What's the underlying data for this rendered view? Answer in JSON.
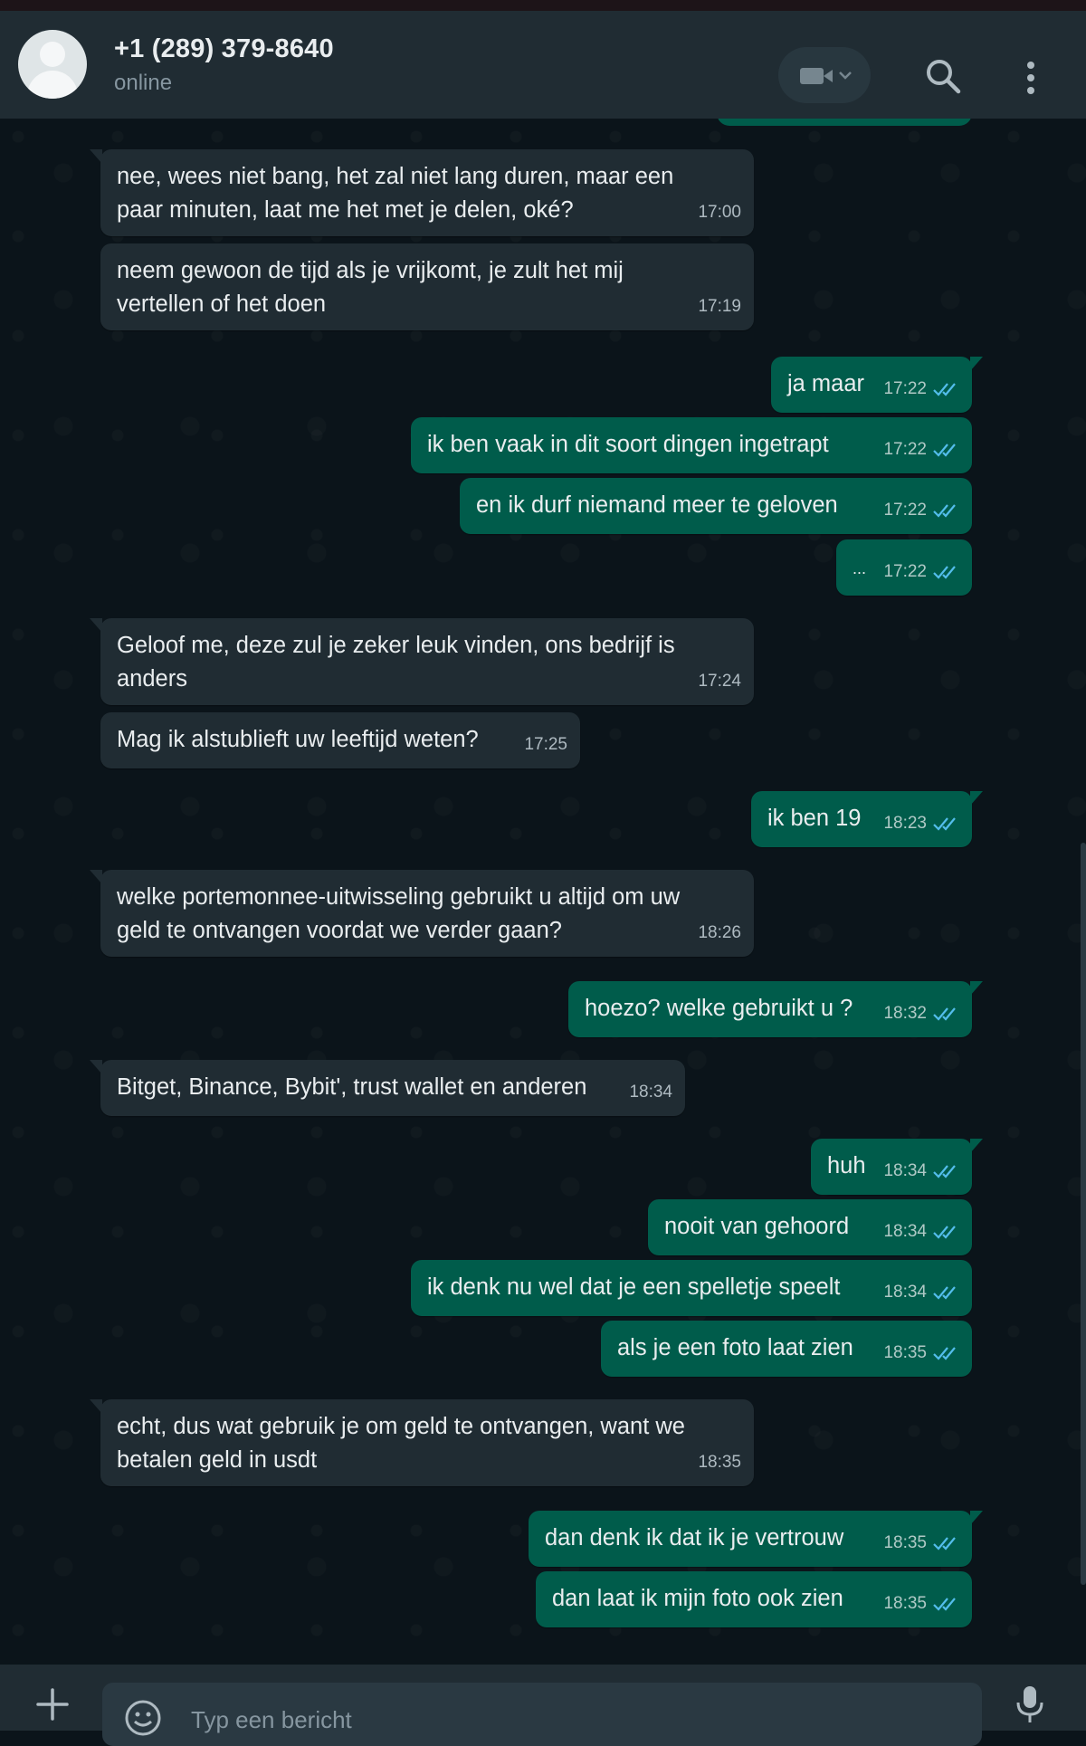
{
  "header": {
    "contact_name": "+1 (289) 379-8640",
    "status": "online"
  },
  "icons": {
    "avatar": "default-user-avatar",
    "video": "video-camera-icon",
    "search": "search-icon",
    "menu": "vertical-dots-icon",
    "attach": "plus-icon",
    "emoji": "smiley-icon",
    "mic": "microphone-icon",
    "read_receipt": "double-check-icon"
  },
  "colors": {
    "background": "#0b141a",
    "header": "#202c33",
    "incoming_bubble": "#202c33",
    "outgoing_bubble": "#005c4b",
    "read_tick": "#53bdeb"
  },
  "messages": [
    {
      "dir": "in",
      "text": "nee, wees niet bang, het zal niet lang duren, maar een\npaar minuten, laat me het met je delen, oké?",
      "time": "17:00"
    },
    {
      "dir": "in",
      "text": "neem gewoon de tijd als je vrijkomt, je zult het mij\nvertellen of het doen",
      "time": "17:19"
    },
    {
      "dir": "out",
      "text": "ja maar",
      "time": "17:22"
    },
    {
      "dir": "out",
      "text": "ik ben vaak in dit soort dingen ingetrapt",
      "time": "17:22"
    },
    {
      "dir": "out",
      "text": "en ik durf niemand meer te geloven",
      "time": "17:22"
    },
    {
      "dir": "out",
      "text": "...",
      "time": "17:22"
    },
    {
      "dir": "in",
      "text": "Geloof me, deze zul je zeker leuk vinden, ons bedrijf is\nanders",
      "time": "17:24"
    },
    {
      "dir": "in",
      "text": "Mag ik alstublieft uw leeftijd weten?",
      "time": "17:25"
    },
    {
      "dir": "out",
      "text": "ik ben 19",
      "time": "18:23"
    },
    {
      "dir": "in",
      "text": "welke portemonnee-uitwisseling gebruikt u altijd om uw\ngeld te ontvangen voordat we verder gaan?",
      "time": "18:26"
    },
    {
      "dir": "out",
      "text": "hoezo? welke gebruikt u ?",
      "time": "18:32"
    },
    {
      "dir": "in",
      "text": "Bitget, Binance, Bybit', trust wallet en anderen",
      "time": "18:34"
    },
    {
      "dir": "out",
      "text": "huh",
      "time": "18:34"
    },
    {
      "dir": "out",
      "text": "nooit van gehoord",
      "time": "18:34"
    },
    {
      "dir": "out",
      "text": "ik denk nu wel dat je een spelletje speelt",
      "time": "18:34"
    },
    {
      "dir": "out",
      "text": "als je een foto laat zien",
      "time": "18:35"
    },
    {
      "dir": "in",
      "text": "echt, dus wat gebruik je om geld te ontvangen, want we\nbetalen geld in usdt",
      "time": "18:35"
    },
    {
      "dir": "out",
      "text": "dan denk ik dat ik je vertrouw",
      "time": "18:35"
    },
    {
      "dir": "out",
      "text": "dan laat ik mijn foto ook zien",
      "time": "18:35"
    }
  ],
  "composer": {
    "placeholder": "Typ een bericht"
  }
}
